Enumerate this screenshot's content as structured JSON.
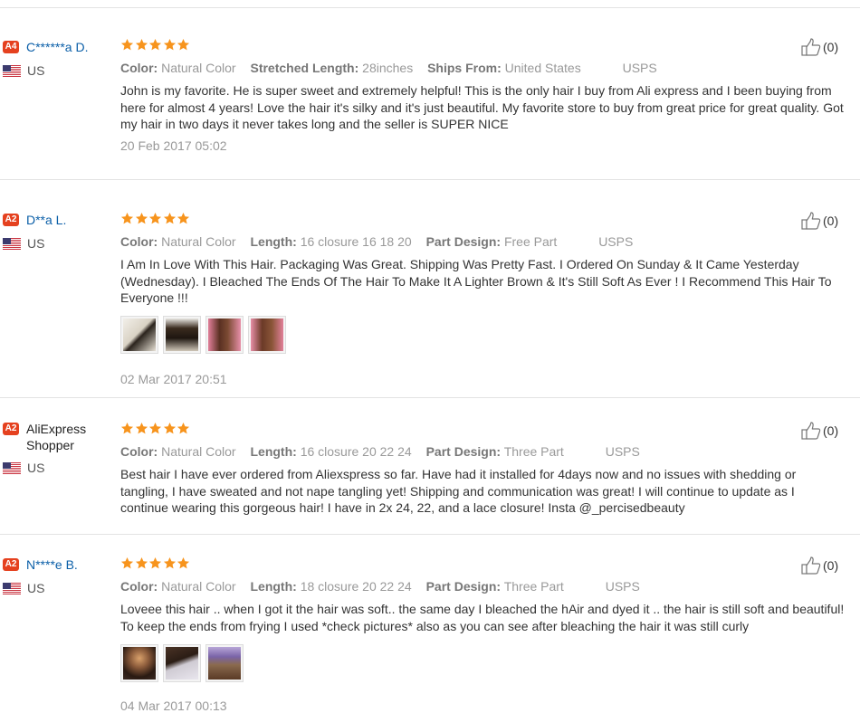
{
  "labels": {
    "color": "Color:",
    "stretched_length": "Stretched Length:",
    "length": "Length:",
    "ships_from": "Ships From:",
    "part_design": "Part Design:"
  },
  "reviews": [
    {
      "level": "A4",
      "name": "C******a D.",
      "country": "US",
      "rating": 5,
      "color": "Natural Color",
      "stretched_length": "28inches",
      "ships_from": "United States",
      "shipping": "USPS",
      "text": "John is my favorite. He is super sweet and extremely helpful! This is the only hair I buy from Ali express and I been buying from here for almost 4 years! Love the hair it's silky and it's just beautiful. My favorite store to buy from great price for great quality. Got my hair in two days it never takes long and the seller is SUPER NICE",
      "date": "20 Feb 2017 05:02",
      "helpful": "(0)"
    },
    {
      "level": "A2",
      "name": "D**a L.",
      "country": "US",
      "rating": 5,
      "color": "Natural Color",
      "length": "16 closure 16 18 20",
      "part_design": "Free Part",
      "shipping": "USPS",
      "text": "I Am In Love With This Hair. Packaging Was Great. Shipping Was Pretty Fast. I Ordered On Sunday & It Came Yesterday (Wednesday). I Bleached The Ends Of The Hair To Make It A Lighter Brown & It's Still Soft As Ever ! I Recommend This Hair To Everyone !!!",
      "date": "02 Mar 2017 20:51",
      "helpful": "(0)"
    },
    {
      "level": "A2",
      "name": "AliExpress Shopper",
      "country": "US",
      "rating": 5,
      "color": "Natural Color",
      "length": "16 closure 20 22 24",
      "part_design": "Three Part",
      "shipping": "USPS",
      "text": "Best hair I have ever ordered from Aliexspress so far. Have had it installed for 4days now and no issues with shedding or tangling, I have sweated and not nape tangling yet! Shipping and communication was great! I will continue to update as I continue wearing this gorgeous hair! I have in 2x 24, 22, and a lace closure! Insta @_percisedbeauty",
      "date": "",
      "helpful": "(0)"
    },
    {
      "level": "A2",
      "name": "N****e B.",
      "country": "US",
      "rating": 5,
      "color": "Natural Color",
      "length": "18 closure 20 22 24",
      "part_design": "Three Part",
      "shipping": "USPS",
      "text": "Loveee this hair .. when I got it the hair was soft.. the same day I bleached the hAir and dyed it .. the hair is still soft and beautiful! To keep the ends from frying I used *check pictures* also as you can see after bleaching the hair it was still curly",
      "date": "04 Mar 2017 00:13",
      "helpful": "(0)"
    }
  ],
  "colors": {
    "star": "#f7941d",
    "level_badge": "#e5411f",
    "link": "#0b5fa8"
  }
}
